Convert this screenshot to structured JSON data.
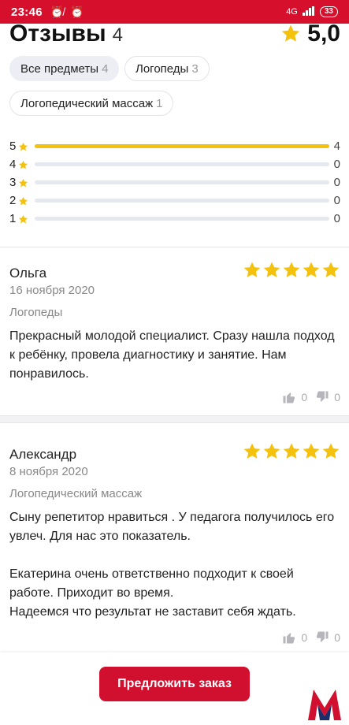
{
  "status_bar": {
    "time": "23:46",
    "network": "4G",
    "battery": "33"
  },
  "header": {
    "title": "Отзывы",
    "count": "4",
    "rating": "5,0"
  },
  "filters": [
    {
      "label": "Все предметы",
      "count": "4",
      "active": true
    },
    {
      "label": "Логопеды",
      "count": "3",
      "active": false
    },
    {
      "label": "Логопедический массаж",
      "count": "1",
      "active": false
    }
  ],
  "distribution": [
    {
      "stars": "5",
      "count": "4",
      "fraction": 1.0
    },
    {
      "stars": "4",
      "count": "0",
      "fraction": 0.0
    },
    {
      "stars": "3",
      "count": "0",
      "fraction": 0.0
    },
    {
      "stars": "2",
      "count": "0",
      "fraction": 0.0
    },
    {
      "stars": "1",
      "count": "0",
      "fraction": 0.0
    }
  ],
  "reviews": [
    {
      "name": "Ольга",
      "date": "16 ноября 2020",
      "subject": "Логопеды",
      "rating": 5,
      "text": [
        "Прекрасный молодой специалист. Сразу нашла подход к ребёнку, провела диагностику и занятие. Нам понравилось."
      ],
      "likes": "0",
      "dislikes": "0"
    },
    {
      "name": "Александр",
      "date": "8 ноября 2020",
      "subject": "Логопедический массаж",
      "rating": 5,
      "text": [
        "Сыну репетитор нравиться . У педагога получилось его увлеч. Для нас это показатель.",
        "",
        "Екатерина очень ответственно подходит к своей работе. Приходит во время.",
        "Надеемся что результат не заставит себя ждать."
      ],
      "likes": "0",
      "dislikes": "0"
    }
  ],
  "cta": {
    "label": "Предложить заказ"
  },
  "colors": {
    "brand": "#d0102e",
    "star": "#f4c20d",
    "track": "#e6e8f0"
  },
  "icons": [
    "alarm-off-icon",
    "alarm-icon",
    "signal-icon",
    "star-icon",
    "thumb-up-icon",
    "thumb-down-icon",
    "brand-logo"
  ]
}
